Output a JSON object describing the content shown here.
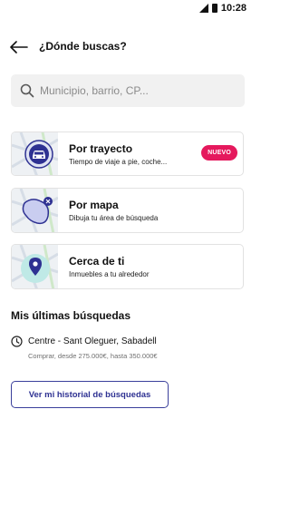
{
  "status_bar": {
    "time": "10:28",
    "icons": [
      "signal-icon",
      "battery-icon"
    ]
  },
  "header": {
    "title": "¿Dónde buscas?",
    "back_icon": "arrow-left-icon"
  },
  "search": {
    "placeholder": "Municipio, barrio, CP...",
    "value": "",
    "icon": "search-icon"
  },
  "options": [
    {
      "title": "Por trayecto",
      "subtitle": "Tiempo de viaje a pie, coche...",
      "icon": "car-icon",
      "badge": "NUEVO"
    },
    {
      "title": "Por mapa",
      "subtitle": "Dibuja tu área de búsqueda",
      "icon": "draw-area-icon"
    },
    {
      "title": "Cerca de ti",
      "subtitle": "Inmuebles a tu alrededor",
      "icon": "location-pin-icon"
    }
  ],
  "recent": {
    "section_title": "Mis últimas búsquedas",
    "items": [
      {
        "title": "Centre - Sant Oleguer, Sabadell",
        "subtitle": "Comprar, desde 275.000€, hasta 350.000€",
        "icon": "clock-icon"
      }
    ]
  },
  "history_button": {
    "label": "Ver mi historial de búsquedas"
  },
  "colors": {
    "accent": "#2e3192",
    "badge": "#e5195d",
    "search_bg": "#f1f1f1",
    "card_border": "#e2e2e2",
    "map_bg": "#eef1f4"
  }
}
